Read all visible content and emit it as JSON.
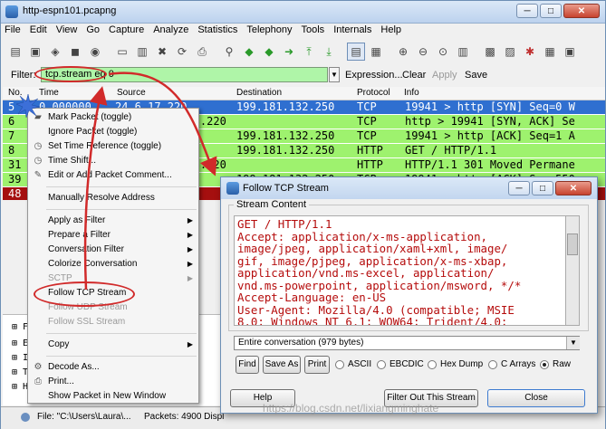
{
  "window": {
    "title": "http-espn101.pcapng",
    "min": "─",
    "max": "□",
    "close": "✕"
  },
  "menubar": [
    "File",
    "Edit",
    "View",
    "Go",
    "Capture",
    "Analyze",
    "Statistics",
    "Telephony",
    "Tools",
    "Internals",
    "Help"
  ],
  "toolbar_icons": [
    "interfaces-icon",
    "options-icon",
    "start-icon",
    "stop-icon",
    "restart-icon",
    "open-icon",
    "save-icon",
    "close-file-icon",
    "reload-icon",
    "print-icon",
    "find-icon",
    "back-icon",
    "forward-icon",
    "goto-icon",
    "first-icon",
    "last-icon",
    "colorize-icon",
    "autoscroll-icon",
    "zoom-in-icon",
    "zoom-out-icon",
    "normal-size-icon",
    "resize-icon",
    "capture-filters-icon",
    "display-filters-icon",
    "coloring-rules-icon",
    "preferences-icon",
    "help-icon"
  ],
  "filter": {
    "label": "Filter:",
    "value": "tcp.stream eq 0",
    "expression": "Expression...",
    "clear": "Clear",
    "apply": "Apply",
    "save": "Save"
  },
  "packet_list": {
    "headers": {
      "no": "No.",
      "time": "Time",
      "source": "Source",
      "destination": "Destination",
      "protocol": "Protocol",
      "info": "Info"
    },
    "rows": [
      {
        "no": "5",
        "time": "0.000000",
        "source": "24.6.17.220",
        "destination": "199.181.132.250",
        "protocol": "TCP",
        "info": "19941 > http [SYN] Seq=0 W",
        "style": "sel"
      },
      {
        "no": "6",
        "time": "",
        "source": ".250 24.6.173.220",
        "destination": "",
        "protocol": "TCP",
        "info": "http > 19941 [SYN, ACK] Se",
        "style": "green"
      },
      {
        "no": "7",
        "time": "",
        "source": "0",
        "destination": "199.181.132.250",
        "protocol": "TCP",
        "info": "19941 > http [ACK] Seq=1 A",
        "style": "green"
      },
      {
        "no": "8",
        "time": "",
        "source": "0",
        "destination": "199.181.132.250",
        "protocol": "HTTP",
        "info": "GET / HTTP/1.1",
        "style": "green"
      },
      {
        "no": "31",
        "time": "",
        "source": ".250 24.6.173.220",
        "destination": "",
        "protocol": "HTTP",
        "info": "HTTP/1.1 301 Moved Permane",
        "style": "green"
      },
      {
        "no": "39",
        "time": "",
        "source": "0",
        "destination": "199.181.132.250",
        "protocol": "TCP",
        "info": "19941 > http [ACK] Seq=550",
        "style": "green"
      },
      {
        "no": "48",
        "time": "",
        "source": "0",
        "destination": "",
        "protocol": "",
        "info": "",
        "style": "red"
      }
    ]
  },
  "details_lines": [
    "⊞  F",
    "⊞  E",
    "⊞  I",
    "⊞  T",
    "⊞  H"
  ],
  "statusbar": {
    "file": "File: \"C:\\Users\\Laura\\...",
    "packets": "Packets: 4900 Displ"
  },
  "context_menu": [
    {
      "label": "Mark Packet (toggle)",
      "icon": "mark-icon"
    },
    {
      "label": "Ignore Packet (toggle)",
      "icon": ""
    },
    {
      "label": "Set Time Reference (toggle)",
      "icon": "clock-icon"
    },
    {
      "label": "Time Shift...",
      "icon": "clock-icon"
    },
    {
      "label": "Edit or Add Packet Comment...",
      "icon": "comment-icon"
    },
    {
      "sep": true
    },
    {
      "label": "Manually Resolve Address",
      "icon": ""
    },
    {
      "sep": true
    },
    {
      "label": "Apply as Filter",
      "submenu": true
    },
    {
      "label": "Prepare a Filter",
      "submenu": true
    },
    {
      "label": "Conversation Filter",
      "submenu": true
    },
    {
      "label": "Colorize Conversation",
      "submenu": true
    },
    {
      "label": "SCTP",
      "submenu": true,
      "disabled": true
    },
    {
      "label": "Follow TCP Stream"
    },
    {
      "label": "Follow UDP Stream",
      "disabled": true
    },
    {
      "label": "Follow SSL Stream",
      "disabled": true
    },
    {
      "sep": true
    },
    {
      "label": "Copy",
      "submenu": true
    },
    {
      "sep": true
    },
    {
      "label": "Decode As...",
      "icon": "decode-icon"
    },
    {
      "label": "Print...",
      "icon": "print-icon"
    },
    {
      "label": "Show Packet in New Window",
      "icon": ""
    }
  ],
  "dialog": {
    "title": "Follow TCP Stream",
    "stream_content_label": "Stream Content",
    "stream_text": "GET / HTTP/1.1\nAccept: application/x-ms-application,\nimage/jpeg, application/xaml+xml, image/\ngif, image/pjpeg, application/x-ms-xbap,\napplication/vnd.ms-excel, application/\nvnd.ms-powerpoint, application/msword, */*\nAccept-Language: en-US\nUser-Agent: Mozilla/4.0 (compatible; MSIE\n8.0; Windows NT 6.1; WOW64; Trident/4.0;",
    "conversation": "Entire conversation (979 bytes)",
    "find": "Find",
    "save_as": "Save As",
    "print": "Print",
    "formats": [
      "ASCII",
      "EBCDIC",
      "Hex Dump",
      "C Arrays",
      "Raw"
    ],
    "selected_format": "Raw",
    "help": "Help",
    "filter_out": "Filter Out This Stream",
    "close": "Close"
  },
  "watermark": "https://blog.csdn.net/lixiangminghate",
  "colors": {
    "green_row": "#9ef26e",
    "selected_row": "#2f6fd0",
    "red_row": "#a50f0f",
    "filter_ok": "#aff5a8",
    "stream_text": "#b50c0c",
    "annotation": "#d12a2a"
  }
}
